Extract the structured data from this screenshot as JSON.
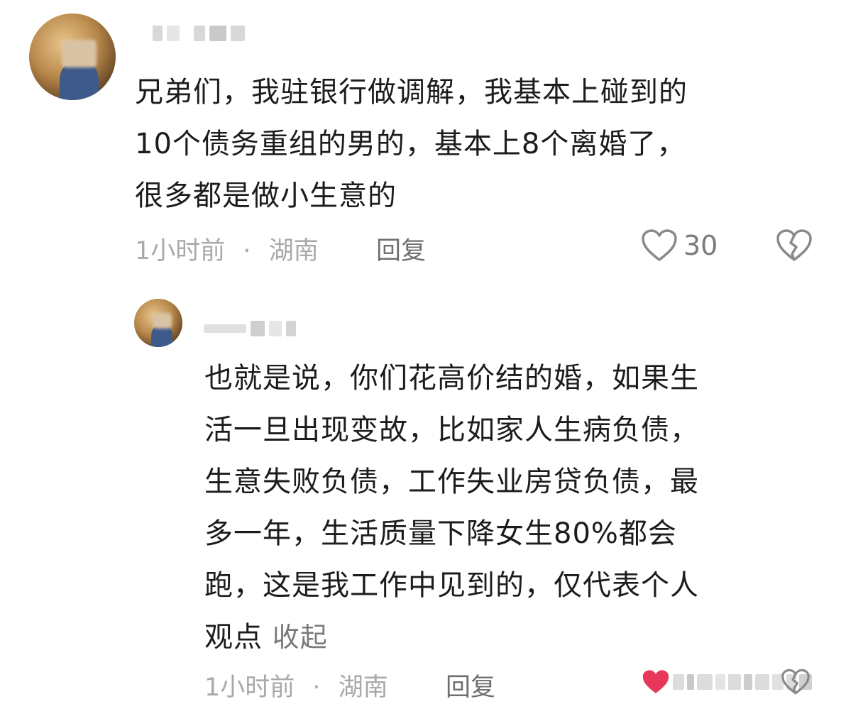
{
  "comments": [
    {
      "text_lines": [
        "兄弟们，我驻银行做调解，我基本上碰到的",
        "10个债务重组的男的，基本上8个离婚了，",
        "很多都是做小生意的"
      ],
      "time": "1小时前",
      "separator": "·",
      "location": "湖南",
      "reply_label": "回复",
      "like_count": "30",
      "icons": {
        "like": "heart-outline-icon",
        "dislike": "broken-heart-icon"
      }
    },
    {
      "text_lines": [
        "也就是说，你们花高价结的婚，如果生",
        "活一旦出现变故，比如家人生病负债，",
        "生意失败负债，工作失业房贷负债，最",
        "多一年，生活质量下降女生80%都会",
        "跑，这是我工作中见到的，仅代表个人",
        "观点"
      ],
      "collapse_label": "收起",
      "time": "1小时前",
      "separator": "·",
      "location": "湖南",
      "reply_label": "回复",
      "icons": {
        "like": "heart-filled-icon"
      },
      "colors": {
        "like": "#e8385a"
      }
    }
  ]
}
